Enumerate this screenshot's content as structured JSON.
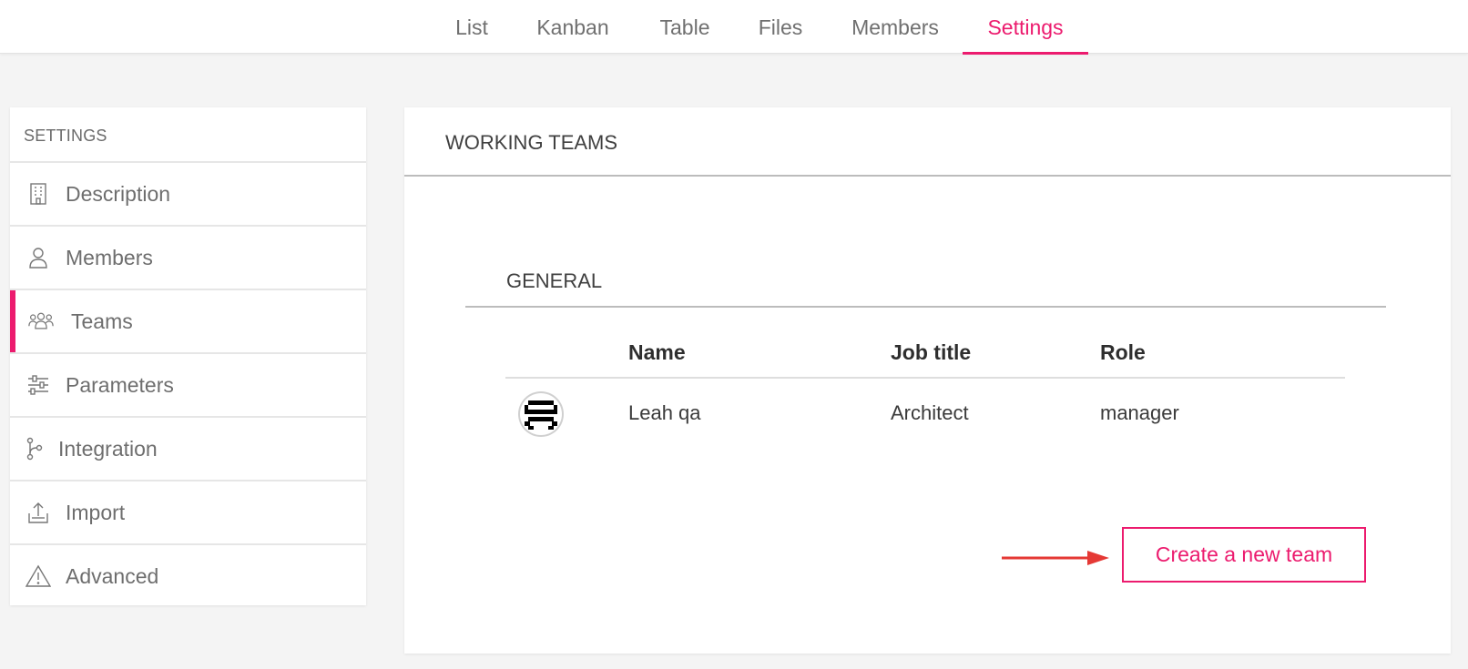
{
  "tabs": [
    {
      "label": "List"
    },
    {
      "label": "Kanban"
    },
    {
      "label": "Table"
    },
    {
      "label": "Files"
    },
    {
      "label": "Members"
    },
    {
      "label": "Settings",
      "active": true
    }
  ],
  "sidebar": {
    "header": "SETTINGS",
    "items": [
      {
        "label": "Description",
        "icon": "building-icon"
      },
      {
        "label": "Members",
        "icon": "user-icon"
      },
      {
        "label": "Teams",
        "icon": "team-icon",
        "active": true
      },
      {
        "label": "Parameters",
        "icon": "sliders-icon"
      },
      {
        "label": "Integration",
        "icon": "git-branch-icon"
      },
      {
        "label": "Import",
        "icon": "upload-icon"
      },
      {
        "label": "Advanced",
        "icon": "warning-icon"
      }
    ]
  },
  "main": {
    "title": "WORKING TEAMS",
    "section_title": "GENERAL",
    "columns": [
      "Name",
      "Job title",
      "Role"
    ],
    "rows": [
      {
        "name": "Leah qa",
        "job_title": "Architect",
        "role": "manager",
        "avatar": "pixel-avatar-icon"
      }
    ],
    "create_button": "Create a new team"
  },
  "colors": {
    "accent": "#ec1b6e",
    "arrow": "#e53935",
    "background": "#f4f4f4"
  }
}
